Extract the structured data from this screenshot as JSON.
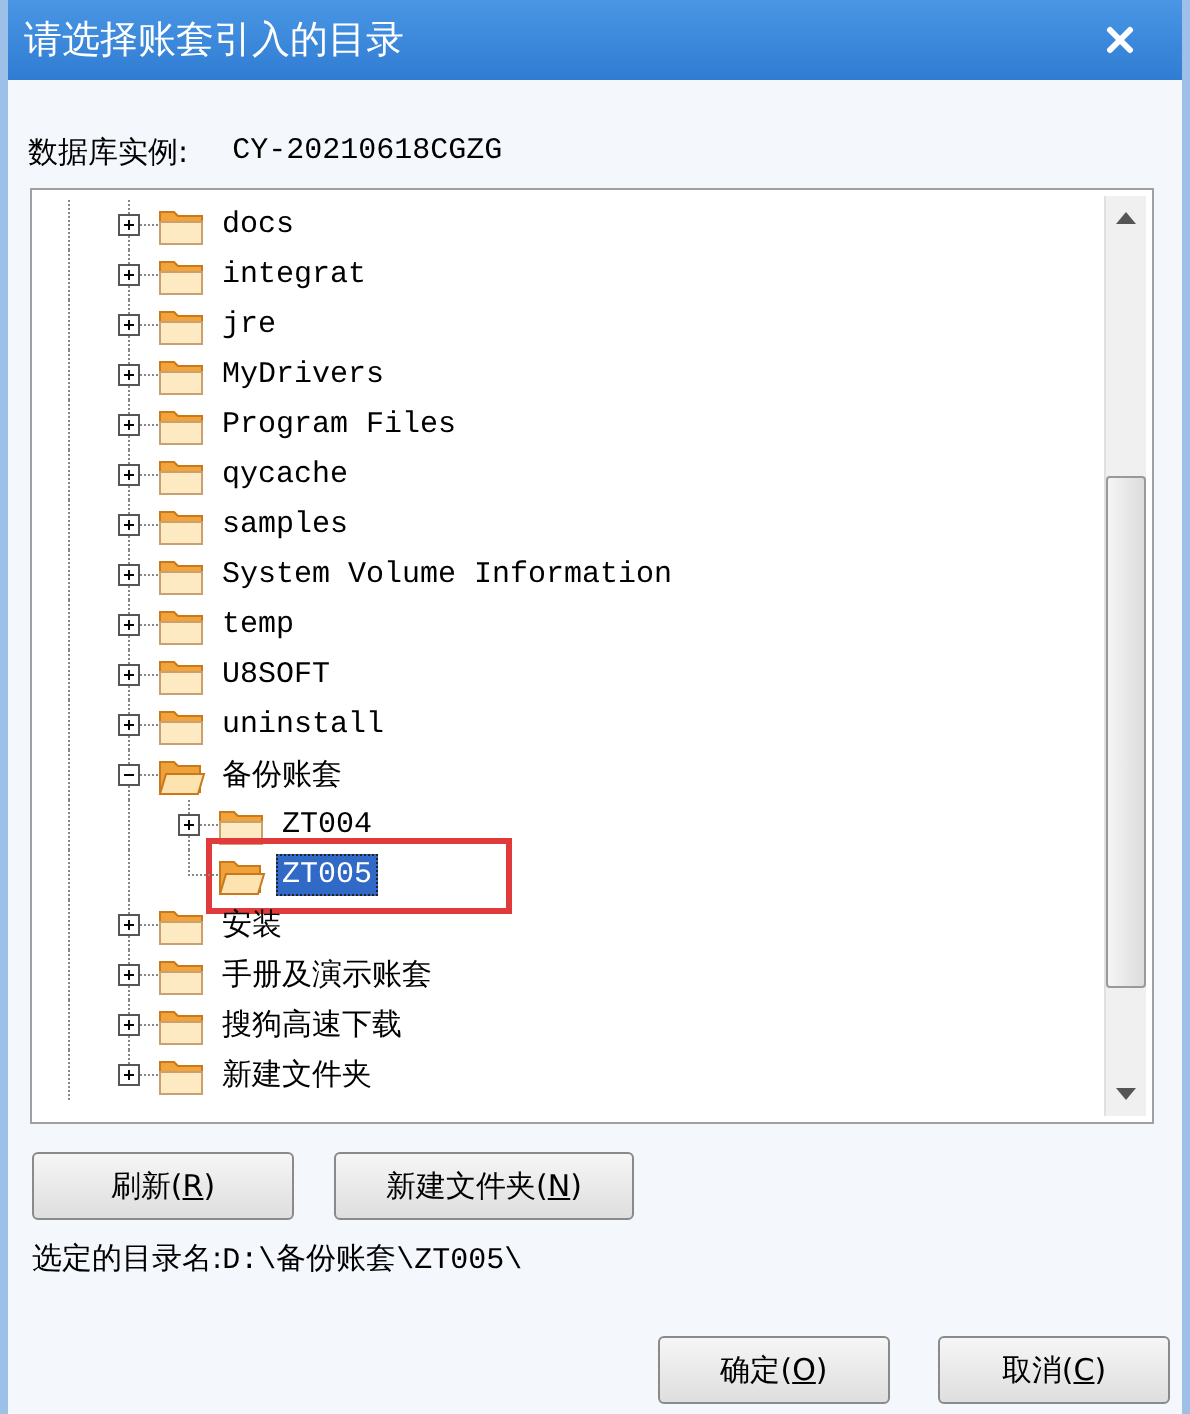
{
  "window": {
    "title": "请选择账套引入的目录"
  },
  "database_instance": {
    "label": "数据库实例:",
    "value": "CY-20210618CGZG"
  },
  "tree": [
    {
      "label": "docs",
      "expanded": false,
      "selected": false
    },
    {
      "label": "integrat",
      "expanded": false,
      "selected": false
    },
    {
      "label": "jre",
      "expanded": false,
      "selected": false
    },
    {
      "label": "MyDrivers",
      "expanded": false,
      "selected": false
    },
    {
      "label": "Program Files",
      "expanded": false,
      "selected": false
    },
    {
      "label": "qycache",
      "expanded": false,
      "selected": false
    },
    {
      "label": "samples",
      "expanded": false,
      "selected": false
    },
    {
      "label": "System Volume Information",
      "expanded": false,
      "selected": false
    },
    {
      "label": "temp",
      "expanded": false,
      "selected": false
    },
    {
      "label": "U8SOFT",
      "expanded": false,
      "selected": false
    },
    {
      "label": "uninstall",
      "expanded": false,
      "selected": false
    },
    {
      "label": "备份账套",
      "expanded": true,
      "selected": false,
      "children": [
        {
          "label": "ZT004",
          "expanded": false,
          "selected": false
        },
        {
          "label": "ZT005",
          "selected": true,
          "marked": true
        }
      ]
    },
    {
      "label": "安装",
      "expanded": false,
      "selected": false
    },
    {
      "label": "手册及演示账套",
      "expanded": false,
      "selected": false
    },
    {
      "label": "搜狗高速下载",
      "expanded": false,
      "selected": false
    },
    {
      "label": "新建文件夹",
      "expanded": false,
      "selected": false
    }
  ],
  "tool_buttons": [
    {
      "before": "刷新(",
      "key": "R",
      "after": ")"
    },
    {
      "before": "新建文件夹(",
      "key": "N",
      "after": ")"
    }
  ],
  "selected_directory": {
    "label": "选定的目录名:",
    "value": "D:\\备份账套\\ZT005\\"
  },
  "dialog_buttons": [
    {
      "before": "确定(",
      "key": "O",
      "after": ")"
    },
    {
      "before": "取消(",
      "key": "C",
      "after": ")"
    }
  ]
}
